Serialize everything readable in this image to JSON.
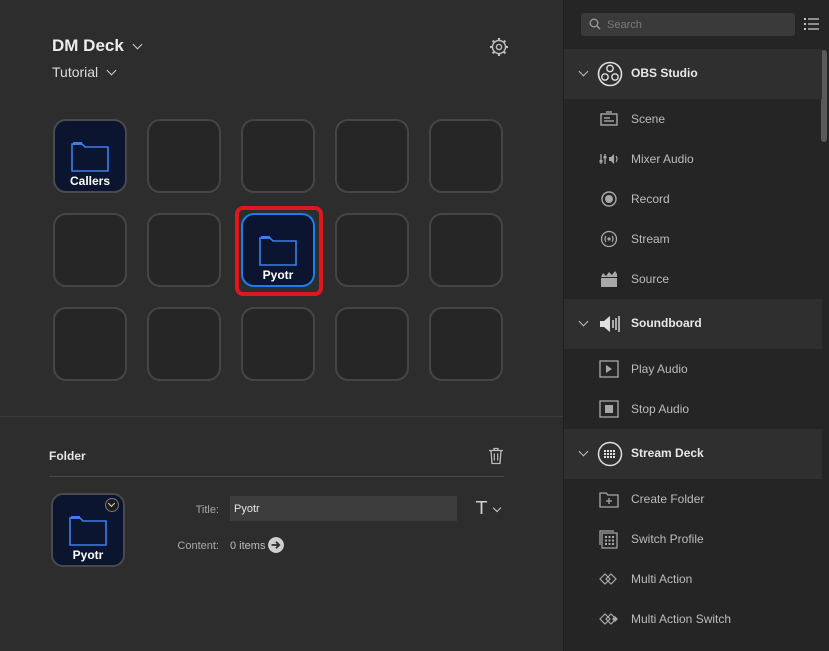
{
  "header": {
    "device_name": "DM Deck",
    "profile_name": "Tutorial"
  },
  "keys": {
    "callers_label": "Callers",
    "pyotr_label": "Pyotr"
  },
  "inspector": {
    "heading": "Folder",
    "title_label": "Title:",
    "title_value": "Pyotr",
    "content_label": "Content:",
    "content_value": "0 items",
    "preview_label": "Pyotr"
  },
  "actions_panel": {
    "search_placeholder": "Search",
    "categories": [
      {
        "label": "OBS Studio",
        "icon": "obs-icon",
        "items": [
          {
            "label": "Scene",
            "icon": "scene-icon"
          },
          {
            "label": "Mixer Audio",
            "icon": "mixer-audio-icon"
          },
          {
            "label": "Record",
            "icon": "record-icon"
          },
          {
            "label": "Stream",
            "icon": "stream-icon"
          },
          {
            "label": "Source",
            "icon": "source-icon"
          }
        ]
      },
      {
        "label": "Soundboard",
        "icon": "speaker-icon",
        "items": [
          {
            "label": "Play Audio",
            "icon": "play-audio-icon"
          },
          {
            "label": "Stop Audio",
            "icon": "stop-audio-icon"
          }
        ]
      },
      {
        "label": "Stream Deck",
        "icon": "stream-deck-icon",
        "items": [
          {
            "label": "Create Folder",
            "icon": "create-folder-icon"
          },
          {
            "label": "Switch Profile",
            "icon": "switch-profile-icon"
          },
          {
            "label": "Multi Action",
            "icon": "multi-action-icon"
          },
          {
            "label": "Multi Action Switch",
            "icon": "multi-action-switch-icon"
          }
        ]
      }
    ]
  },
  "colors": {
    "selection_outline": "#e0171f",
    "selected_key_border": "#1e7bf0",
    "folder_blue": "#3d7fe8"
  }
}
